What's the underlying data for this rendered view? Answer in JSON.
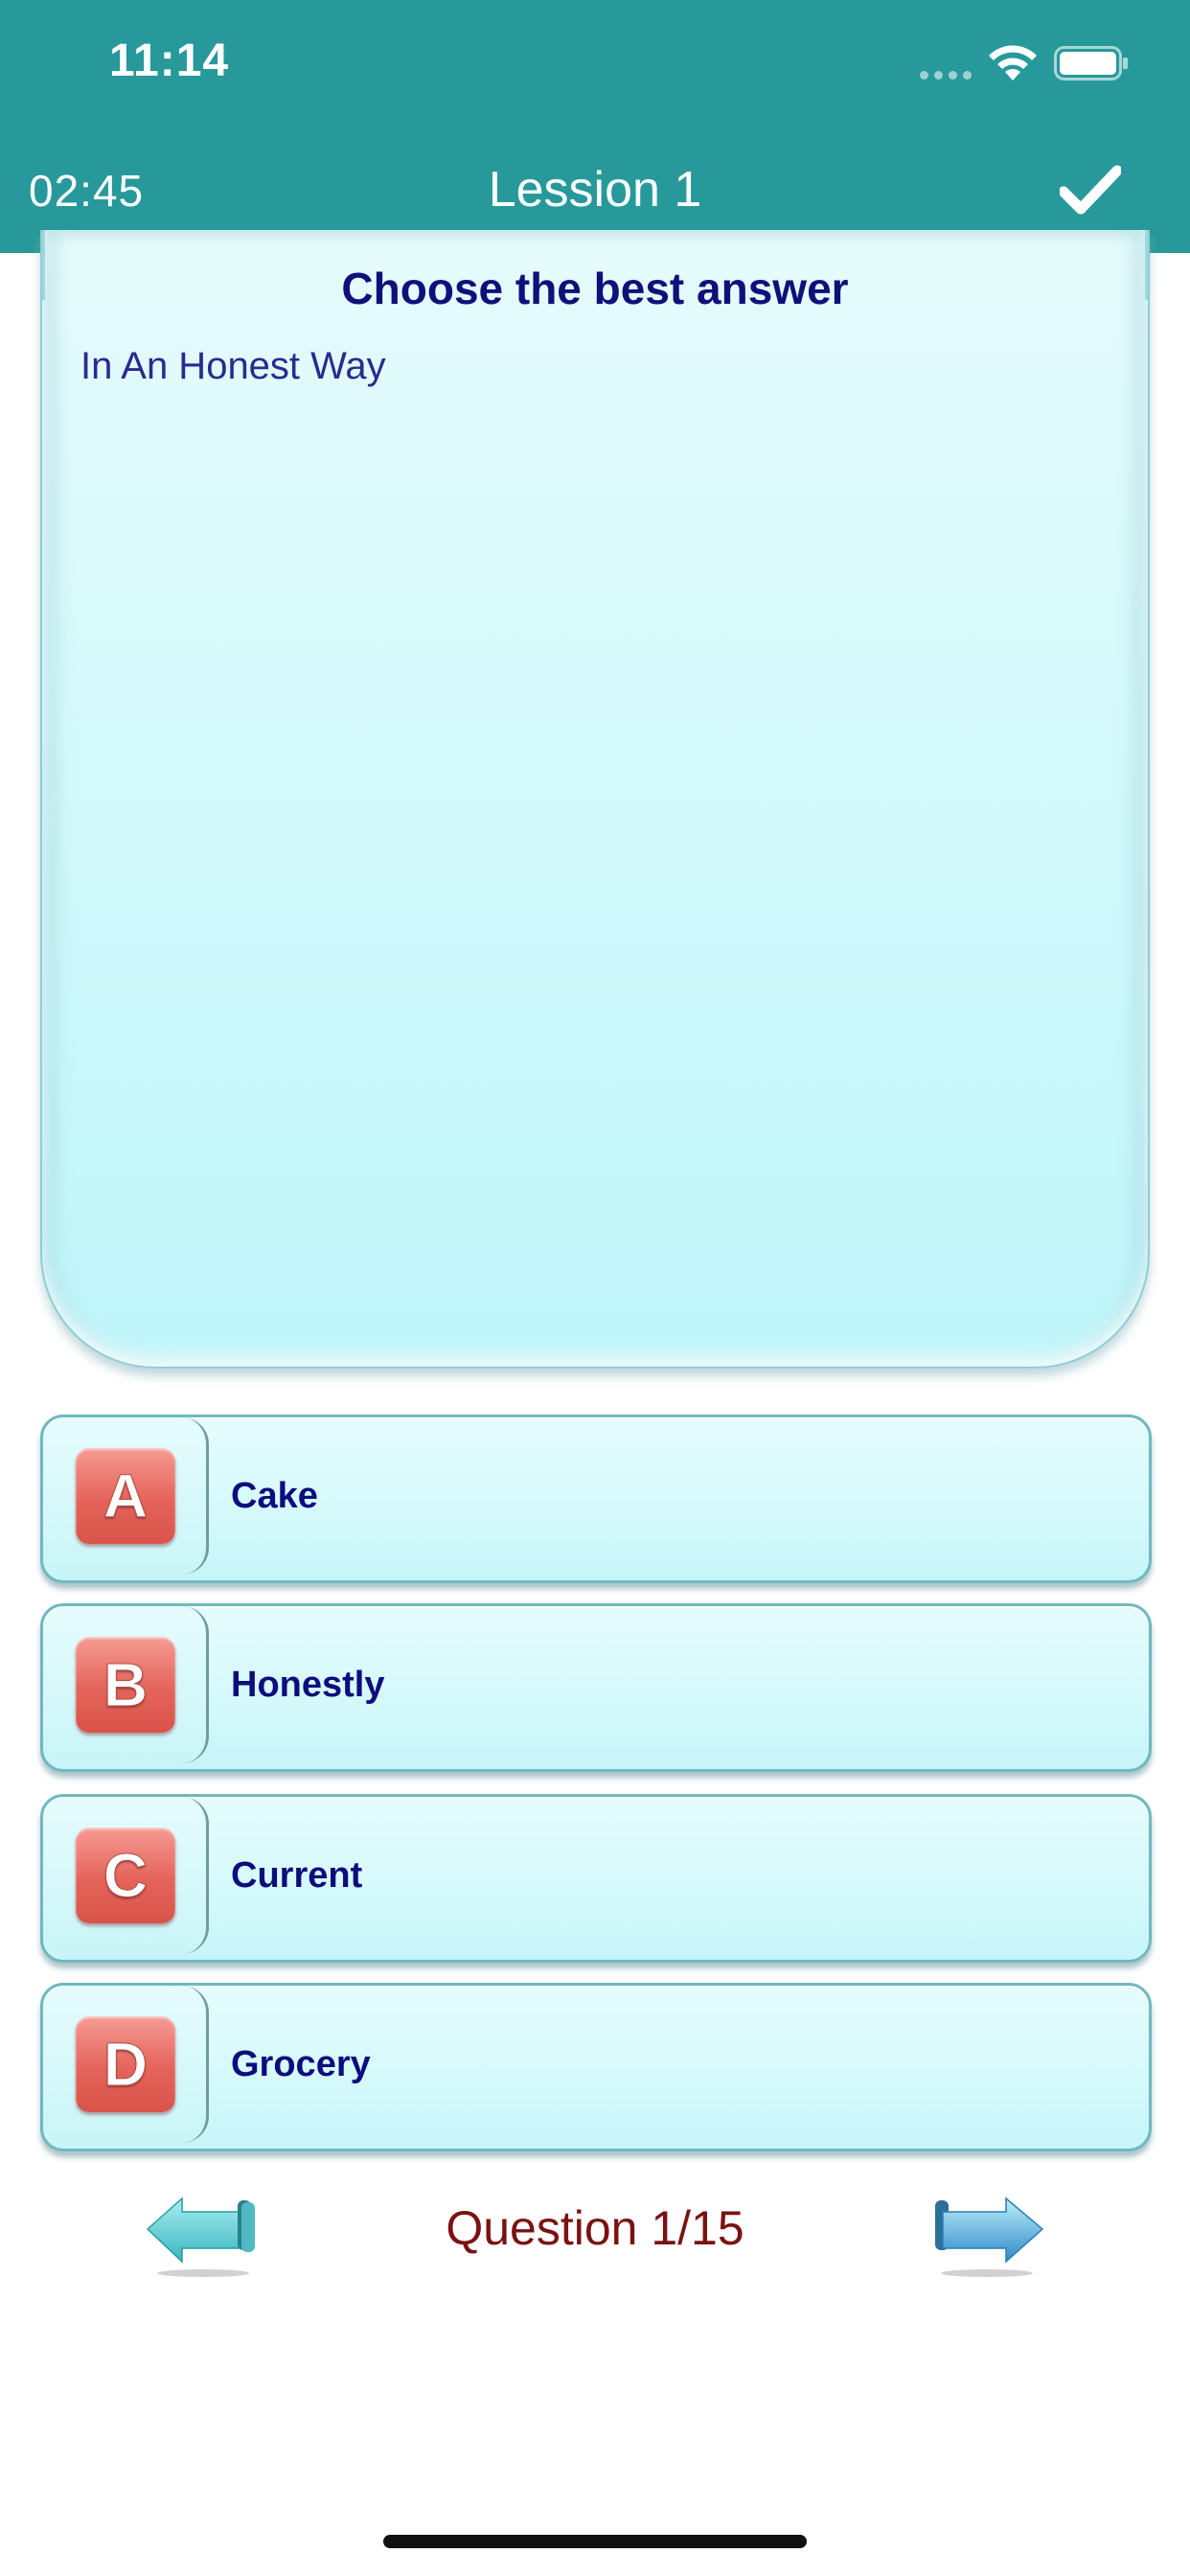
{
  "status_bar": {
    "time": "11:14"
  },
  "header": {
    "timer": "02:45",
    "title": "Lession 1",
    "accent_color": "#27999a",
    "submit_icon": "checkmark-icon"
  },
  "question": {
    "heading": "Choose the best answer",
    "text": "In An Honest Way"
  },
  "answers": [
    {
      "letter": "A",
      "label": "Cake"
    },
    {
      "letter": "B",
      "label": "Honestly"
    },
    {
      "letter": "C",
      "label": "Current"
    },
    {
      "letter": "D",
      "label": "Grocery"
    }
  ],
  "navigation": {
    "counter": "Question 1/15",
    "prev_icon": "arrow-left-icon",
    "next_icon": "arrow-right-icon"
  }
}
